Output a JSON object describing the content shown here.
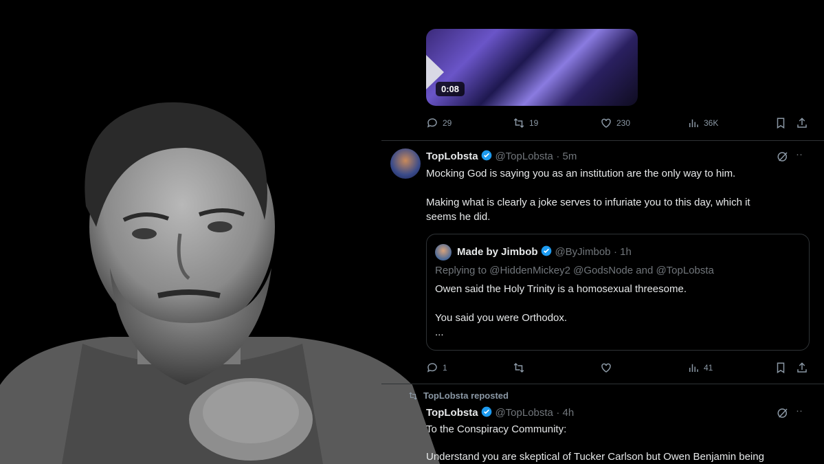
{
  "video": {
    "duration": "0:08"
  },
  "tweet1_actions": {
    "replies": "29",
    "retweets": "19",
    "likes": "230",
    "views": "36K"
  },
  "tweet2": {
    "name": "TopLobsta",
    "handle": "@TopLobsta",
    "time": "· 5m",
    "line1": "Mocking God is saying you as an institution are the only way to him.",
    "line2": "Making what is clearly a joke serves to infuriate you to this day, which it",
    "line3": "seems he did.",
    "more": "··"
  },
  "quote": {
    "name": "Made by Jimbob",
    "handle": "@ByJimbob",
    "time": "· 1h",
    "replying": "Replying to @HiddenMickey2 @GodsNode and @TopLobsta",
    "line1": "Owen said the Holy Trinity is a homosexual threesome.",
    "line2": "You said you were Orthodox.",
    "ellipsis": "..."
  },
  "tweet2_actions": {
    "replies": "1",
    "retweets": "",
    "likes": "",
    "views": "41"
  },
  "repost": {
    "label": "TopLobsta reposted"
  },
  "tweet3": {
    "name": "TopLobsta",
    "handle": "@TopLobsta",
    "time": "· 4h",
    "line1": "To the Conspiracy Community:",
    "line2": "Understand you are skeptical of Tucker Carlson but Owen Benjamin being",
    "more": "··"
  },
  "colors": {
    "background": "#000000",
    "text": "#e7e9ea",
    "muted": "#71767b",
    "verified": "#1d9bf0",
    "divider": "#2f3336"
  },
  "icons": [
    "reply-icon",
    "retweet-icon",
    "like-icon",
    "views-icon",
    "bookmark-icon",
    "share-icon",
    "grok-icon",
    "verified-badge-icon",
    "play-icon"
  ]
}
